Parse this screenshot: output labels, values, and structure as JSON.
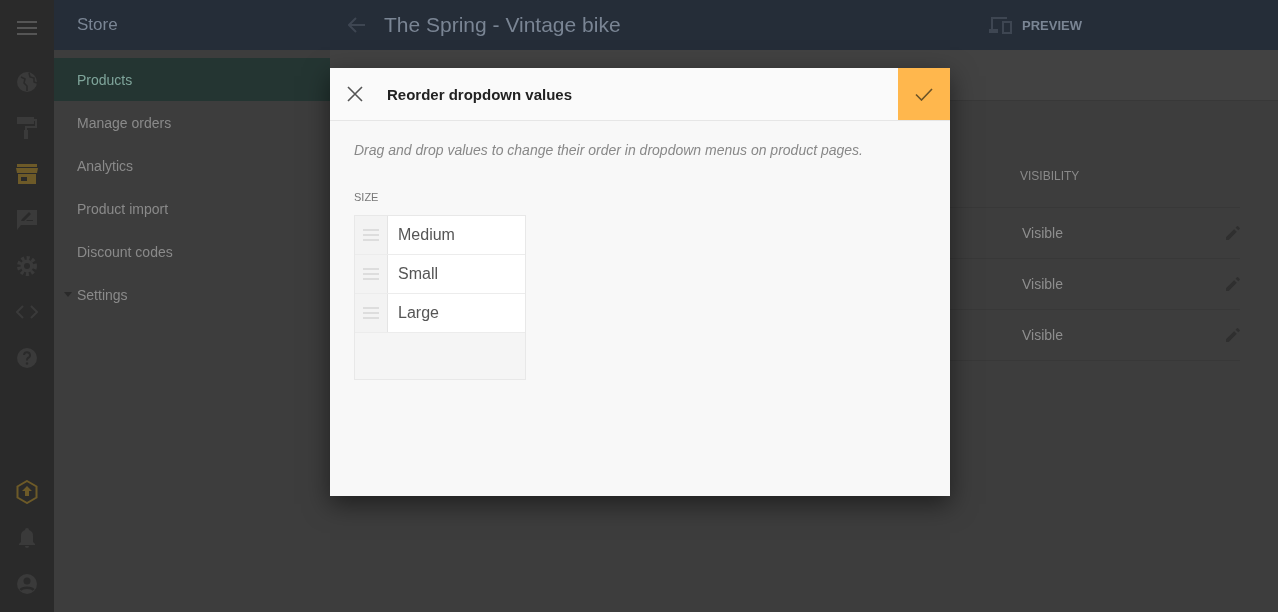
{
  "rail": {
    "items": [
      {
        "selected": false
      },
      {
        "selected": false
      },
      {
        "selected": true
      },
      {
        "selected": false
      },
      {
        "selected": false
      },
      {
        "selected": false
      },
      {
        "selected": false
      }
    ]
  },
  "sidebar": {
    "title": "Store",
    "items": [
      {
        "label": "Products",
        "selected": true
      },
      {
        "label": "Manage orders",
        "selected": false
      },
      {
        "label": "Analytics",
        "selected": false
      },
      {
        "label": "Product import",
        "selected": false
      },
      {
        "label": "Discount codes",
        "selected": false
      },
      {
        "label": "Settings",
        "selected": false,
        "expanded": false
      }
    ]
  },
  "header": {
    "title": "The Spring - Vintage bike",
    "preview": "PREVIEW"
  },
  "table": {
    "column": "VISIBILITY",
    "rows": [
      {
        "visibility": "Visible"
      },
      {
        "visibility": "Visible"
      },
      {
        "visibility": "Visible"
      }
    ]
  },
  "dialog": {
    "title": "Reorder dropdown values",
    "hint": "Drag and drop values to change their order in dropdown menus on product pages.",
    "group": "SIZE",
    "values": [
      "Medium",
      "Small",
      "Large"
    ]
  }
}
